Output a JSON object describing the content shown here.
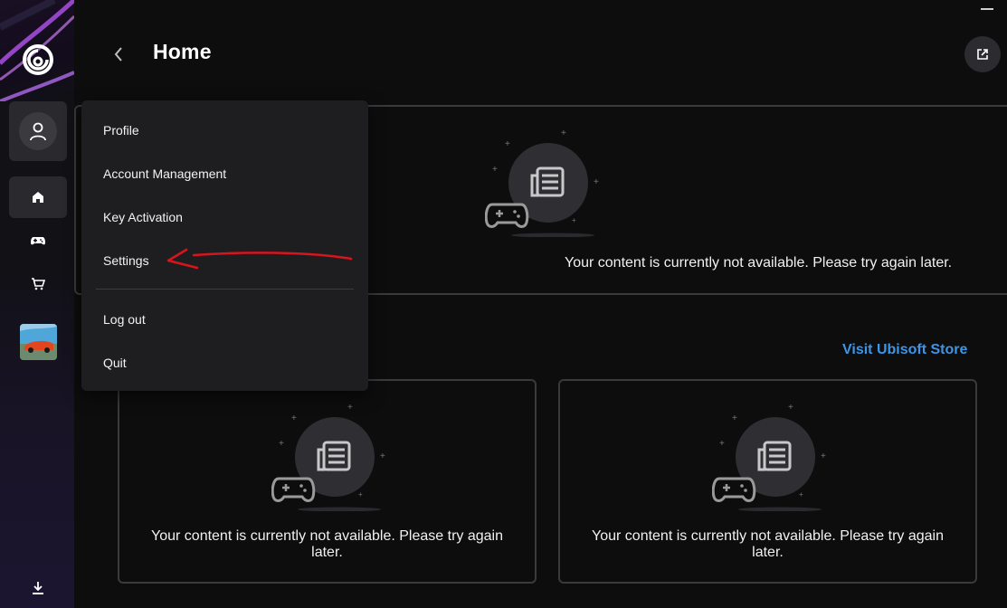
{
  "header": {
    "title": "Home"
  },
  "menu": {
    "items": [
      "Profile",
      "Account Management",
      "Key Activation",
      "Settings"
    ],
    "bottom_items": [
      "Log out",
      "Quit"
    ]
  },
  "cards": {
    "top_message": "Your content is currently not available. Please try again later.",
    "left_message": "Your content is currently not available. Please try again later.",
    "right_message": "Your content is currently not available. Please try again later."
  },
  "store": {
    "link_label": "Visit Ubisoft Store"
  },
  "icons": {
    "logo": "ubisoft-swirl-icon",
    "profile": "user-icon",
    "home": "home-icon",
    "games": "gamepad-icon",
    "store": "cart-icon",
    "download": "download-icon",
    "back": "chevron-left-icon",
    "external": "external-link-icon",
    "placeholder": "news-gamepad-icon"
  },
  "colors": {
    "background": "#0d0d0e",
    "menu_background": "#1e1e21",
    "link_blue": "#3d95e8",
    "annotation_red": "#d8141c"
  }
}
